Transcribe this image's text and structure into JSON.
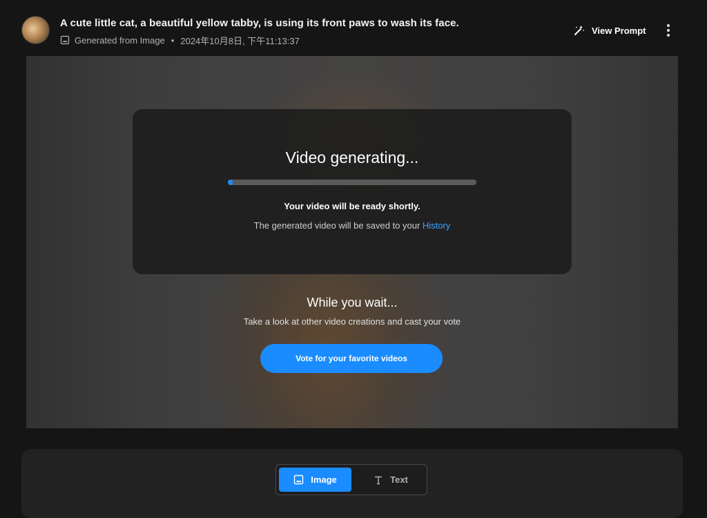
{
  "header": {
    "title": "A cute little cat, a beautiful yellow tabby, is using its front paws to wash its face.",
    "source_label": "Generated from Image",
    "separator": "•",
    "timestamp": "2024年10月8日, 下午11:13:37",
    "view_prompt_label": "View Prompt",
    "avatar_icon": "cat-thumbnail",
    "more_icon": "vertical-ellipsis-icon"
  },
  "status": {
    "title": "Video generating...",
    "progress_percent": 1,
    "ready_text": "Your video will be ready shortly.",
    "saved_text": "The generated video will be saved to your ",
    "history_link": "History"
  },
  "wait": {
    "title": "While you wait...",
    "subtitle": "Take a look at other video creations and cast your vote",
    "vote_button": "Vote for your favorite videos"
  },
  "mode_toggle": {
    "options": [
      {
        "label": "Image",
        "icon": "image-icon",
        "active": true
      },
      {
        "label": "Text",
        "icon": "text-icon",
        "active": false
      }
    ]
  },
  "colors": {
    "accent": "#1a8cff",
    "link": "#3da2ff",
    "background": "#151515"
  }
}
